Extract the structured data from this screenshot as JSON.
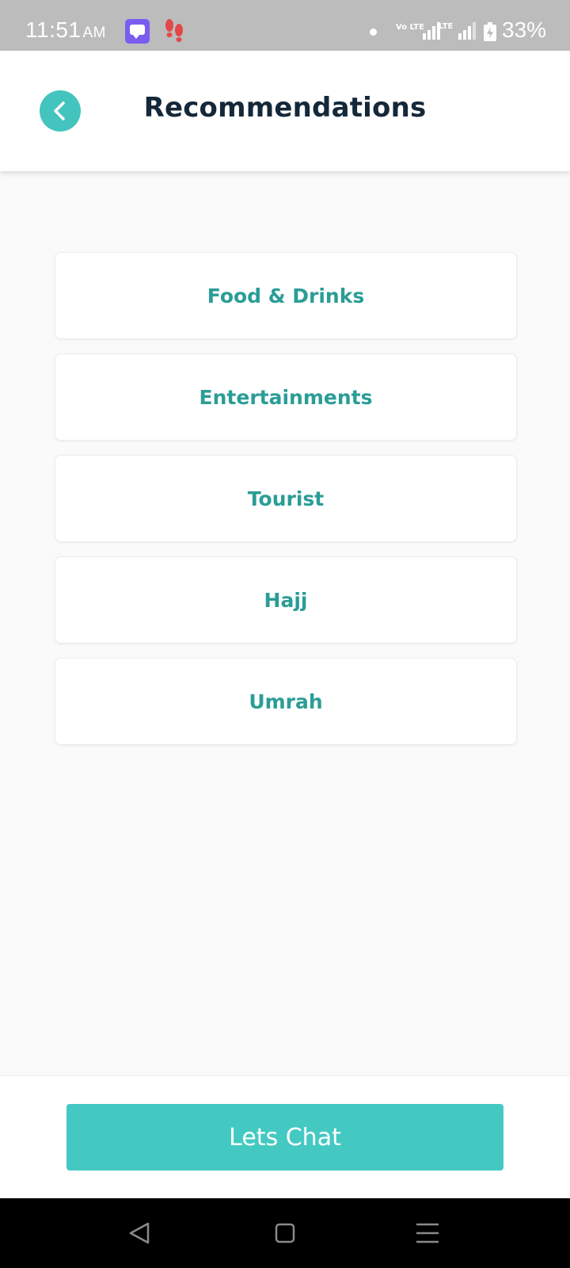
{
  "status_bar": {
    "time": "11:51",
    "ampm": "AM",
    "volte": "Vo LTE",
    "lte": "LTE",
    "battery": "33%"
  },
  "header": {
    "title": "Recommendations"
  },
  "categories": [
    {
      "label": "Food & Drinks"
    },
    {
      "label": "Entertainments"
    },
    {
      "label": "Tourist"
    },
    {
      "label": "Hajj"
    },
    {
      "label": "Umrah"
    }
  ],
  "footer": {
    "chat_label": "Lets Chat"
  },
  "colors": {
    "accent": "#44c4be",
    "card_text": "#2a9d96",
    "title": "#15283a",
    "status_bar": "#bcbcbc"
  },
  "icons": {
    "back": "chevron-left-icon",
    "nav_back": "triangle-back-icon",
    "nav_home": "square-home-icon",
    "nav_menu": "menu-lines-icon"
  }
}
